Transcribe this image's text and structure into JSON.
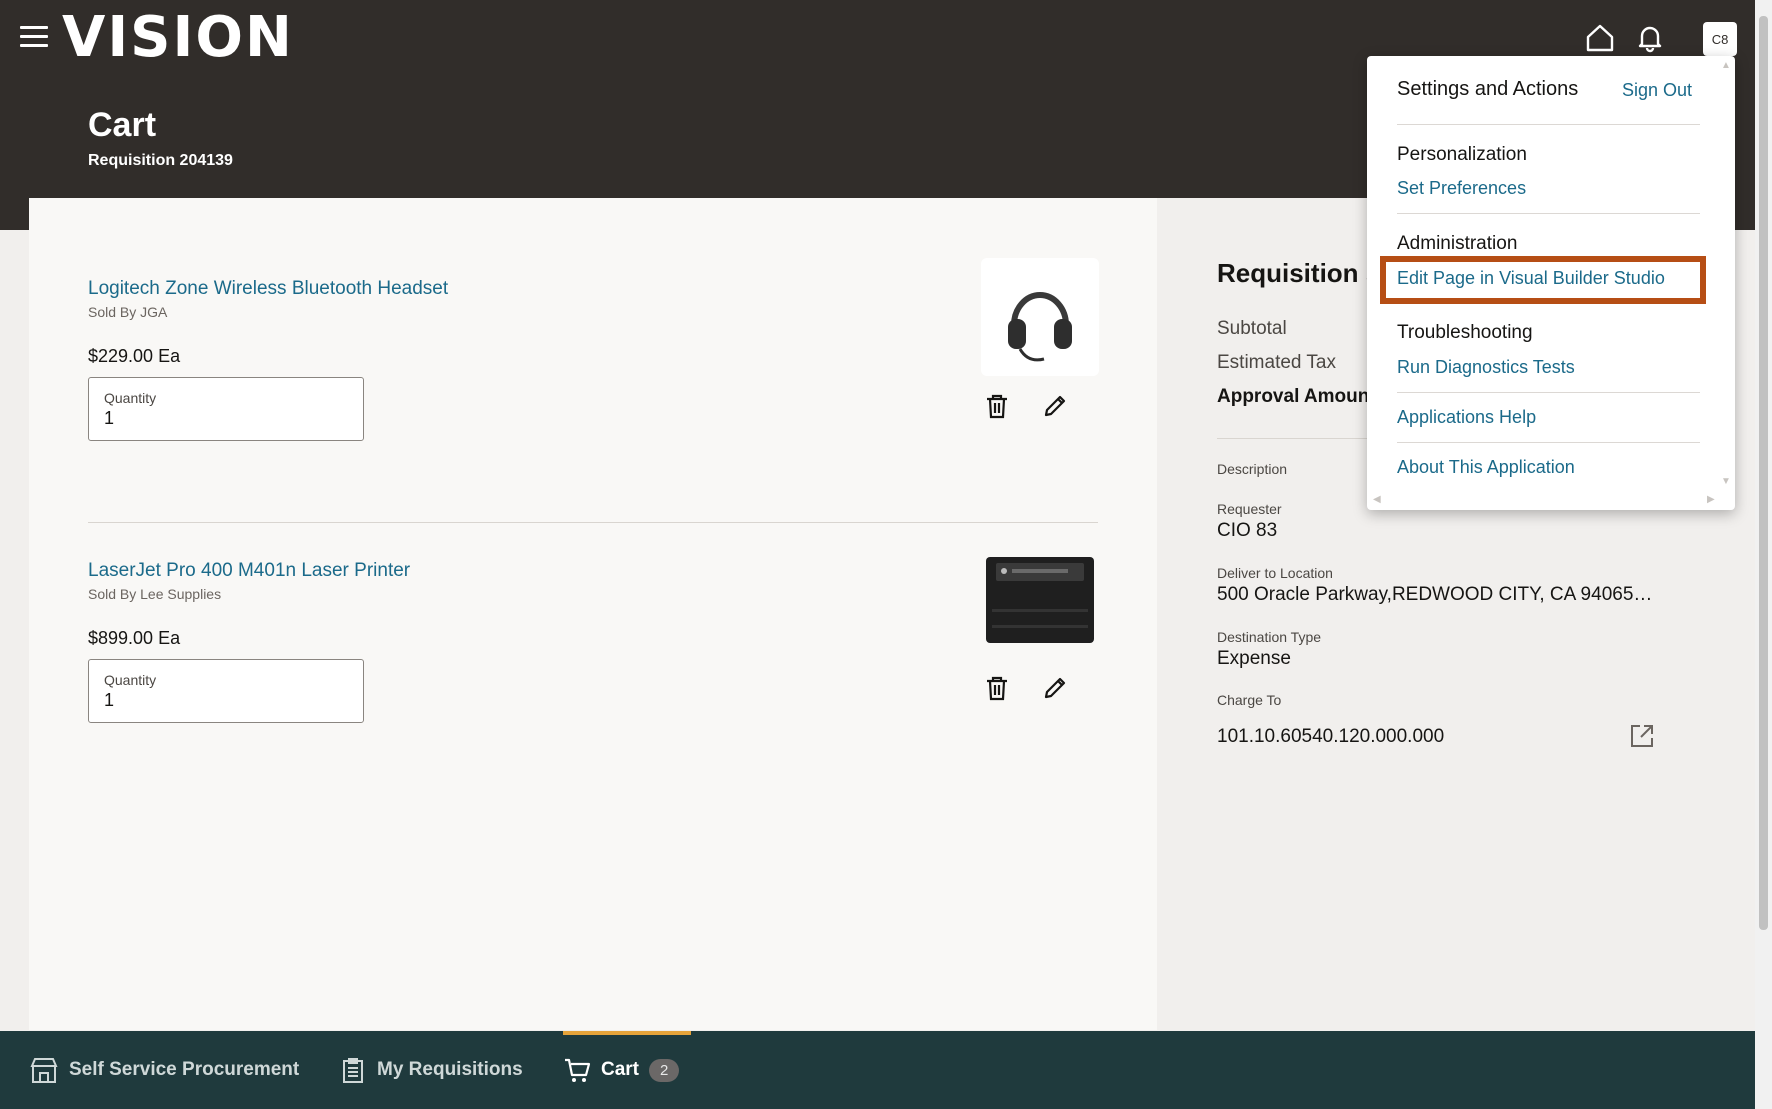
{
  "app": {
    "logo": "VISION",
    "avatar_initials": "C8"
  },
  "page": {
    "title": "Cart",
    "subtitle": "Requisition 204139"
  },
  "items": [
    {
      "name": "Logitech Zone Wireless Bluetooth Headset",
      "seller": "Sold By JGA",
      "price": "$229.00 Ea",
      "qty_label": "Quantity",
      "qty": "1"
    },
    {
      "name": "LaserJet Pro 400 M401n Laser Printer",
      "seller": "Sold By Lee Supplies",
      "price": "$899.00 Ea",
      "qty_label": "Quantity",
      "qty": "1"
    }
  ],
  "summary": {
    "title": "Requisition s",
    "subtotal_label": "Subtotal",
    "tax_label": "Estimated Tax",
    "approval_label": "Approval Amoun",
    "description_label": "Description",
    "requester_label": "Requester",
    "requester": "CIO 83",
    "location_label": "Deliver to Location",
    "location": "500 Oracle Parkway,REDWOOD CITY, CA 94065…",
    "dest_type_label": "Destination Type",
    "dest_type": "Expense",
    "charge_label": "Charge To",
    "charge": "101.10.60540.120.000.000"
  },
  "menu": {
    "title": "Settings and Actions",
    "sign_out": "Sign Out",
    "personalization": "Personalization",
    "set_preferences": "Set Preferences",
    "administration": "Administration",
    "edit_page": "Edit Page in Visual Builder Studio",
    "troubleshooting": "Troubleshooting",
    "run_diagnostics": "Run Diagnostics Tests",
    "applications_help": "Applications Help",
    "about": "About This Application",
    "highlight_color": "#b64e15"
  },
  "bottom_nav": {
    "self_service": "Self Service Procurement",
    "my_requisitions": "My Requisitions",
    "cart": "Cart",
    "cart_count": "2",
    "active_color": "#e6a33a"
  },
  "colors": {
    "header_bg": "#312d2a",
    "link": "#1b6a8a",
    "footer_bg": "#1f3a3d"
  }
}
